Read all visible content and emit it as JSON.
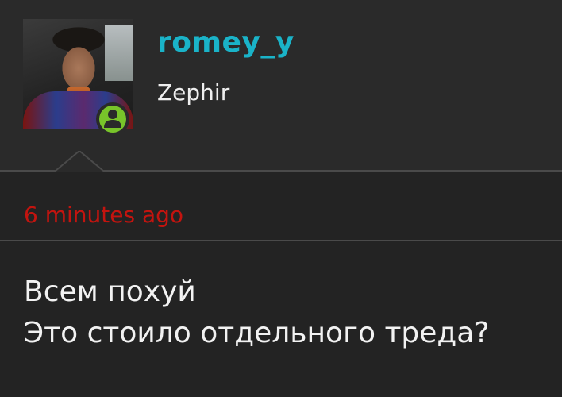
{
  "author": {
    "username": "romey_y",
    "display_name": "Zephir",
    "status": "online",
    "status_icon": "user-icon"
  },
  "post": {
    "timestamp": "6 minutes ago",
    "lines": [
      "Всем похуй",
      "Это стоило отдельного треда?"
    ]
  },
  "colors": {
    "username": "#1ab3c8",
    "timestamp": "#c3140f",
    "status_online": "#78c42a",
    "header_bg": "#2a2a2a",
    "post_bg": "#232323"
  }
}
